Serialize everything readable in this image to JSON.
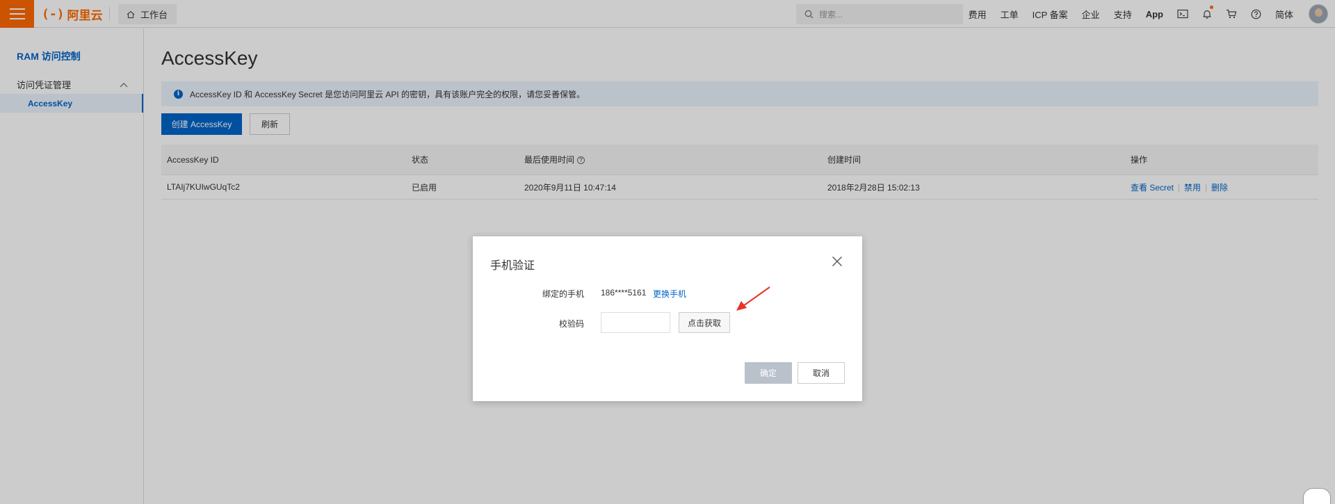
{
  "topbar": {
    "logo_text": "阿里云",
    "workbench_label": "工作台",
    "search_placeholder": "搜索...",
    "nav": [
      "费用",
      "工单",
      "ICP 备案",
      "企业",
      "支持",
      "App"
    ],
    "lang_label": "简体",
    "accent_color": "#ff6a00"
  },
  "sidebar": {
    "title": "RAM 访问控制",
    "group_label": "访问凭证管理",
    "active_item": "AccessKey"
  },
  "main": {
    "page_title": "AccessKey",
    "notice": "AccessKey ID 和 AccessKey Secret 是您访问阿里云 API 的密钥，具有该账户完全的权限，请您妥善保管。",
    "create_button": "创建 AccessKey",
    "refresh_button": "刷新",
    "table": {
      "headers": [
        "AccessKey ID",
        "状态",
        "最后使用时间",
        "创建时间",
        "操作"
      ],
      "rows": [
        {
          "id": "LTAIj7KUIwGUqTc2",
          "status": "已启用",
          "last_used": "2020年9月11日 10:47:14",
          "created": "2018年2月28日 15:02:13",
          "ops": [
            "查看 Secret",
            "禁用",
            "删除"
          ]
        }
      ]
    }
  },
  "dialog": {
    "title": "手机验证",
    "phone_label": "绑定的手机",
    "phone_value": "186****5161",
    "change_phone": "更换手机",
    "code_label": "校验码",
    "get_code_button": "点击获取",
    "ok_button": "确定",
    "cancel_button": "取消"
  },
  "colors": {
    "primary": "#0064c8",
    "annotation_arrow": "#e8332a"
  }
}
